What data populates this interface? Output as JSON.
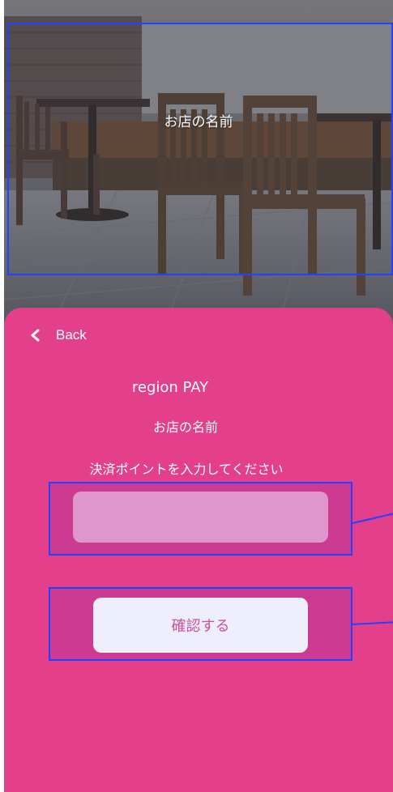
{
  "hero": {
    "store_name": "お店の名前"
  },
  "nav": {
    "back_label": "Back"
  },
  "payment": {
    "app_name": "region PAY",
    "store_name": "お店の名前",
    "prompt": "決済ポイントを入力してください",
    "points_value": "",
    "confirm_label": "確認する"
  },
  "colors": {
    "sheet": "#e43f8a",
    "input_bg": "#de96cc",
    "button_bg": "#eeeefc",
    "button_text": "#c94fa0",
    "annotation": "#1f43ff"
  }
}
